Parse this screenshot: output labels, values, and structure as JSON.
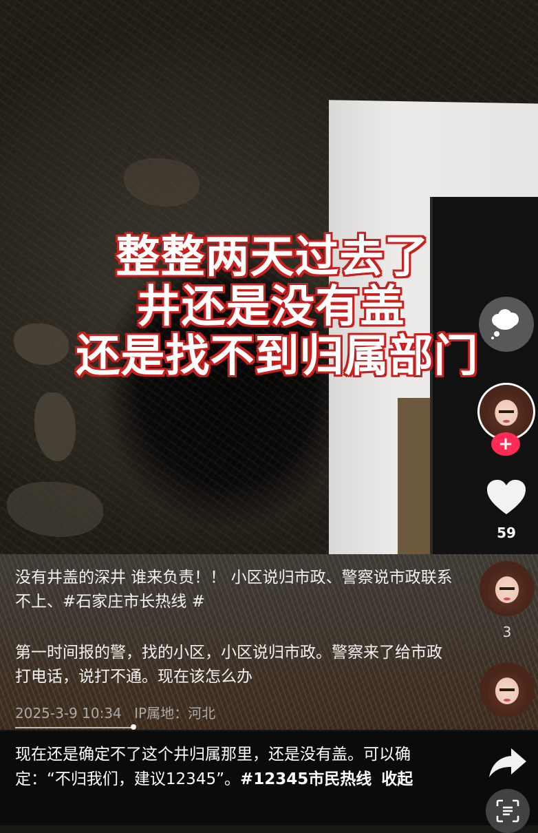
{
  "video": {
    "overlay_lines": [
      "整整两天过去了",
      "井还是没有盖",
      "还是找不到归属部门"
    ]
  },
  "side_rail": {
    "like_count": "59",
    "reply_count": "3",
    "follow_symbol": "+",
    "icons": [
      "comment-bubble-icon",
      "heart-icon",
      "share-arrow-icon",
      "scan-text-icon"
    ]
  },
  "comments": [
    {
      "text": "没有井盖的深井 谁来负责！！ 小区说归市政、警察说市政联系不上、#石家庄市长热线 #"
    },
    {
      "text": "第一时间报的警，找的小区，小区说归市政。警察来了给市政打电话，说打不通。现在该怎么办",
      "date": "2025-3-9 10:34",
      "ip": "IP属地：河北"
    }
  ],
  "caption": {
    "text": "现在还是确定不了这个井归属那里，还是没有盖。可以确定：“不归我们，建议12345”。",
    "hashtag": "#12345市民热线",
    "collapse_label": "收起"
  },
  "colors": {
    "accent_red": "#fe2c55",
    "overlay_outline": "#c8201e"
  }
}
